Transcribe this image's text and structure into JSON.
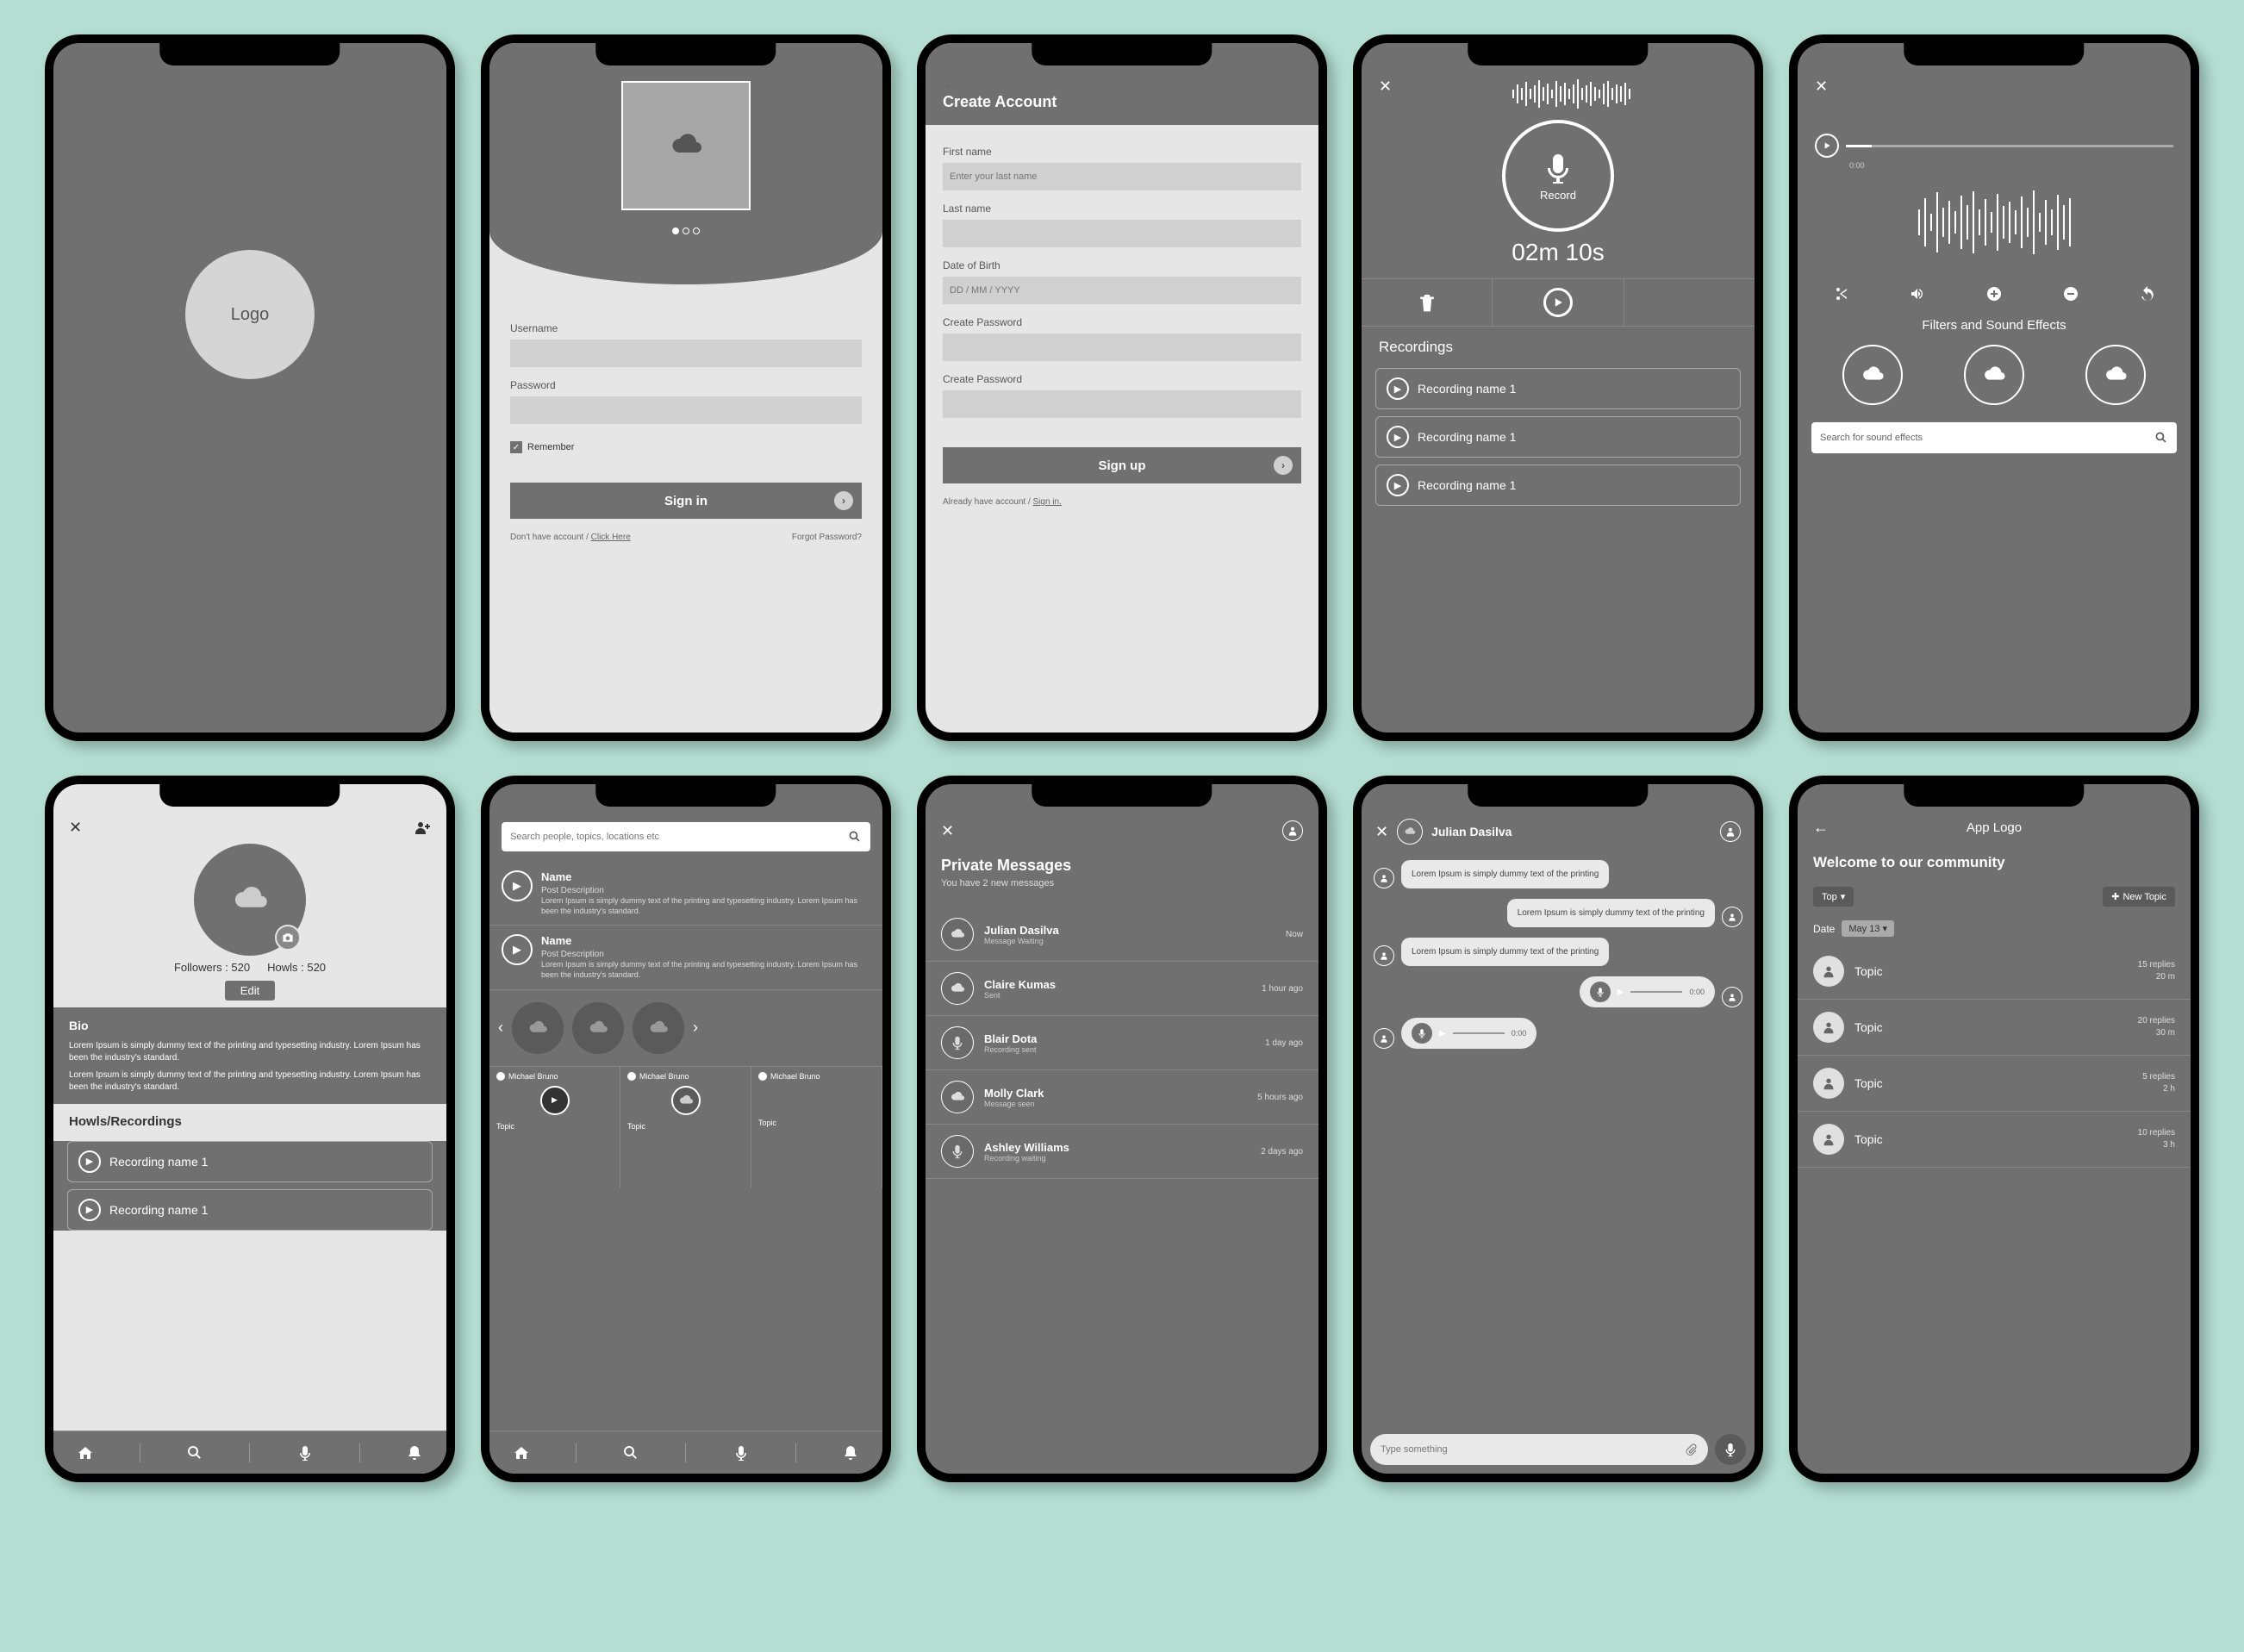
{
  "splash": {
    "logo_text": "Logo"
  },
  "login": {
    "username_label": "Username",
    "password_label": "Password",
    "remember_label": "Remember",
    "signin_label": "Sign in",
    "no_account_prefix": "Don't have account / ",
    "no_account_link": "Click Here",
    "forgot_label": "Forgot Password?"
  },
  "signup": {
    "title": "Create Account",
    "first_name_label": "First name",
    "first_name_placeholder": "Enter your last name",
    "last_name_label": "Last name",
    "dob_label": "Date of Birth",
    "dob_placeholder": "DD / MM / YYYY",
    "pw1_label": "Create Password",
    "pw2_label": "Create Password",
    "signup_label": "Sign up",
    "already_prefix": "Already have account / ",
    "already_link": "Sign in."
  },
  "record": {
    "record_label": "Record",
    "timer": "02m 10s",
    "recordings_title": "Recordings",
    "items": [
      "Recording name 1",
      "Recording name 1",
      "Recording name 1"
    ]
  },
  "editor": {
    "progress_label": "0:00",
    "filters_title": "Filters and Sound Effects",
    "search_placeholder": "Search for sound effects"
  },
  "profile": {
    "followers_label": "Followers : 520",
    "howls_label": "Howls : 520",
    "edit_label": "Edit",
    "bio_title": "Bio",
    "bio_p1": "Lorem Ipsum is simply dummy text of the printing and typesetting industry. Lorem Ipsum has been the industry's standard.",
    "bio_p2": "Lorem Ipsum is simply dummy text of the printing and typesetting industry. Lorem Ipsum has been the industry's standard.",
    "howls_section": "Howls/Recordings",
    "rec_items": [
      "Recording name 1",
      "Recording name 1"
    ]
  },
  "feed": {
    "search_placeholder": "Search people, topics, locations etc",
    "posts": [
      {
        "name": "Name",
        "meta": "Post Description",
        "body": "Lorem Ipsum is simply dummy text of the printing and typesetting industry. Lorem Ipsum has been the industry's standard."
      },
      {
        "name": "Name",
        "meta": "Post Description",
        "body": "Lorem Ipsum is simply dummy text of the printing and typesetting industry. Lorem Ipsum has been the industry's standard."
      }
    ],
    "mini_user": "Michael Bruno",
    "topic_label": "Topic"
  },
  "messages": {
    "title": "Private Messages",
    "subtitle": "You have 2 new messages",
    "items": [
      {
        "name": "Julian Dasilva",
        "status": "Message Waiting",
        "time": "Now",
        "icon": "cloud"
      },
      {
        "name": "Claire Kumas",
        "status": "Sent",
        "time": "1 hour ago",
        "icon": "cloud"
      },
      {
        "name": "Blair Dota",
        "status": "Recording sent",
        "time": "1 day ago",
        "icon": "mic"
      },
      {
        "name": "Molly Clark",
        "status": "Message seen",
        "time": "5 hours ago",
        "icon": "cloud"
      },
      {
        "name": "Ashley Williams",
        "status": "Recording waiting",
        "time": "2 days ago",
        "icon": "mic"
      }
    ]
  },
  "chat": {
    "name": "Julian Dasilva",
    "bubble1": "Lorem Ipsum is simply dummy text of the printing",
    "bubble2": "Lorem Ipsum is simply dummy text of the printing",
    "bubble3": "Lorem Ipsum is simply dummy text of the printing",
    "voice_time": "0:00",
    "input_placeholder": "Type something"
  },
  "community": {
    "logo": "App Logo",
    "welcome": "Welcome to our community",
    "top_label": "Top",
    "new_topic_label": "New Topic",
    "date_label": "Date",
    "date_value": "May 13",
    "topics": [
      {
        "title": "Topic",
        "replies": "15 replies",
        "age": "20 m"
      },
      {
        "title": "Topic",
        "replies": "20 replies",
        "age": "30 m"
      },
      {
        "title": "Topic",
        "replies": "5 replies",
        "age": "2 h"
      },
      {
        "title": "Topic",
        "replies": "10 replies",
        "age": "3 h"
      }
    ]
  }
}
